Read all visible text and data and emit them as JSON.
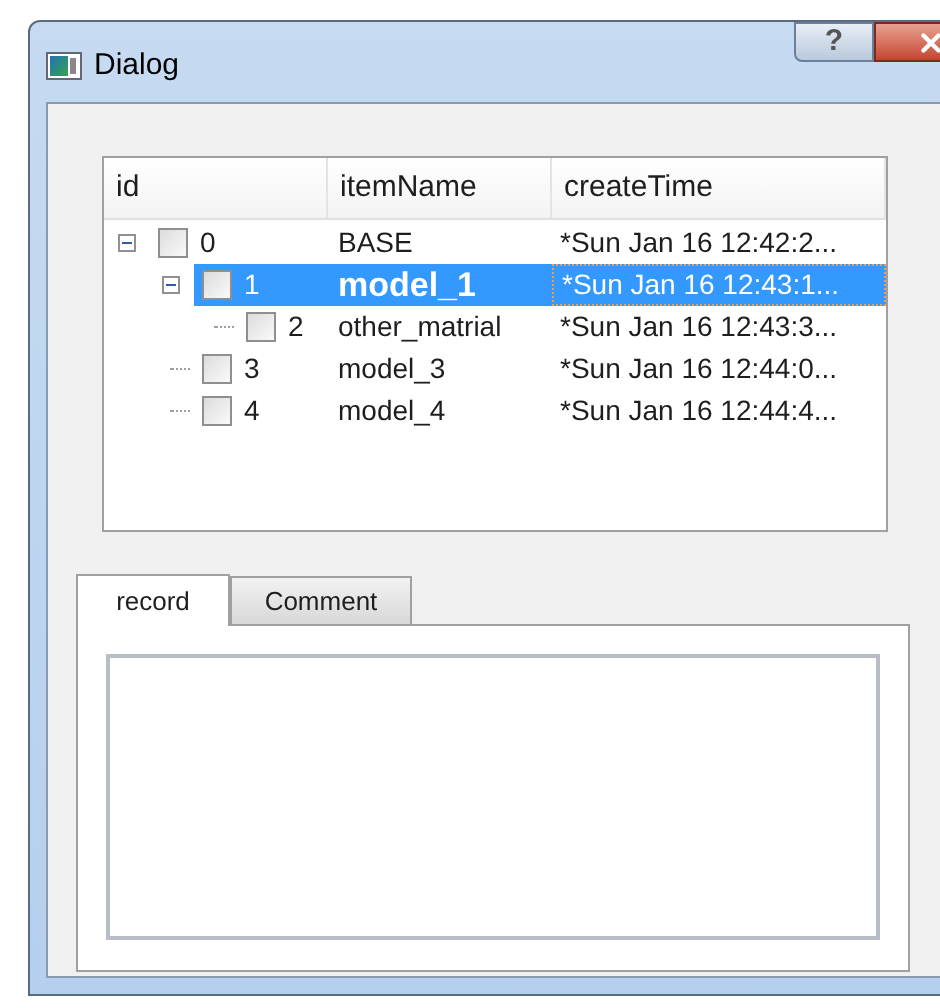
{
  "window": {
    "title": "Dialog",
    "help_button": "?"
  },
  "tree": {
    "columns": [
      "id",
      "itemName",
      "createTime"
    ],
    "rows": [
      {
        "id": "0",
        "item_name": "BASE",
        "create_time": "*Sun Jan 16 12:42:2...",
        "checked": false,
        "selected": false,
        "emphasized": false,
        "expanded": true,
        "children": [
          {
            "id": "1",
            "item_name": "model_1",
            "create_time": "*Sun Jan 16 12:43:1...",
            "checked": false,
            "selected": true,
            "emphasized": true,
            "expanded": true,
            "children": [
              {
                "id": "2",
                "item_name": "other_matrial",
                "create_time": "*Sun Jan 16 12:43:3...",
                "checked": false,
                "selected": false,
                "emphasized": false
              }
            ]
          },
          {
            "id": "3",
            "item_name": "model_3",
            "create_time": "*Sun Jan 16 12:44:0...",
            "checked": false,
            "selected": false,
            "emphasized": false
          },
          {
            "id": "4",
            "item_name": "model_4",
            "create_time": "*Sun Jan 16 12:44:4...",
            "checked": false,
            "selected": false,
            "emphasized": false
          }
        ]
      }
    ]
  },
  "tabs": [
    {
      "label": "record",
      "selected": true
    },
    {
      "label": "Comment",
      "selected": false
    }
  ]
}
